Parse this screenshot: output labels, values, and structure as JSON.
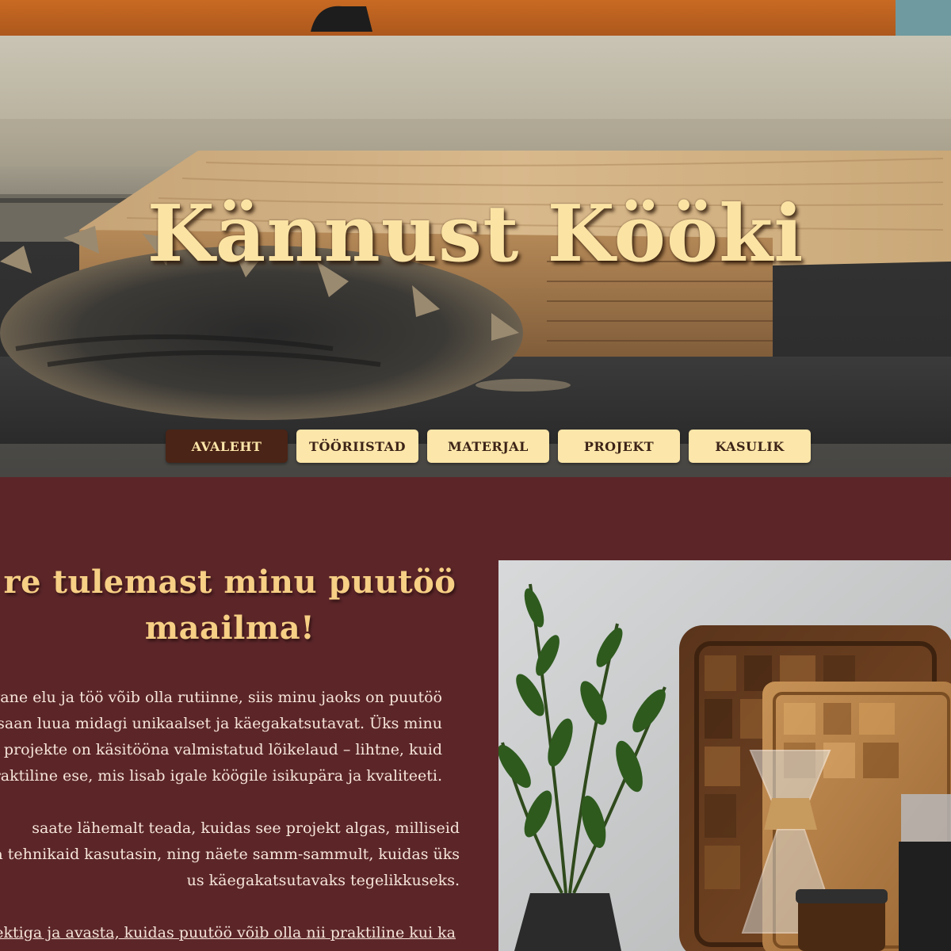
{
  "hero": {
    "title": "Kännust Kööki"
  },
  "nav": {
    "items": [
      {
        "label": "AVALEHT",
        "active": true
      },
      {
        "label": "TÖÖRIISTAD",
        "active": false
      },
      {
        "label": "MATERJAL",
        "active": false
      },
      {
        "label": "PROJEKT",
        "active": false
      },
      {
        "label": "KASULIK",
        "active": false
      }
    ]
  },
  "welcome": {
    "heading_line1": "re tulemast minu puutöö",
    "heading_line2": "maailma!",
    "paragraph1_lines": [
      "evane elu ja töö võib olla rutiinne, siis minu jaoks on puutöö",
      "saan luua midagi unikaalset ja käegakatsutavat. Üks minu",
      "projekte on käsitööna valmistatud lõikelaud – lihtne, kuid",
      "praktiline ese, mis lisab igale köögile isikupära ja kvaliteeti."
    ],
    "paragraph2_lines": [
      "saate lähemalt teada, kuidas see projekt algas, milliseid",
      "ja tehnikaid kasutasin, ning näete samm-sammult, kuidas üks",
      "us käegakatsutavaks tegelikkuseks."
    ],
    "paragraph3_lines": [
      "jektiga ja avasta, kuidas puutöö võib olla nii praktiline kui ka"
    ]
  },
  "colors": {
    "background": "#5c2629",
    "accent": "#fde6a9",
    "active_nav": "#4a2416",
    "heading": "#f7cf85"
  }
}
